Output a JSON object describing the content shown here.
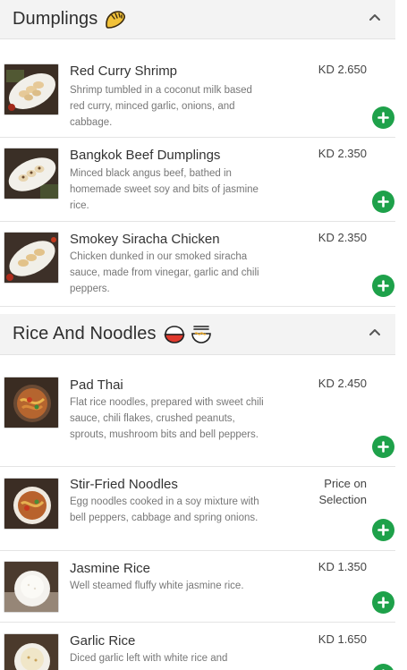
{
  "sections": [
    {
      "title": "Dumplings",
      "emoji_icons": [
        "dumpling-icon"
      ],
      "items": [
        {
          "name": "Red Curry Shrimp",
          "desc": "Shrimp tumbled in a coconut milk based red curry, minced garlic, onions, and cabbage.",
          "price": "KD 2.650",
          "image": "dumplings-photo"
        },
        {
          "name": "Bangkok Beef Dumplings",
          "desc": "Minced black angus beef, bathed in homemade sweet soy and bits of jasmine rice.",
          "price": "KD 2.350",
          "image": "dumplings-photo"
        },
        {
          "name": "Smokey Siracha Chicken",
          "desc": "Chicken dunked in our smoked siracha sauce, made from vinegar, garlic and chili peppers.",
          "price": "KD 2.350",
          "image": "dumplings-photo"
        }
      ]
    },
    {
      "title": "Rice And Noodles",
      "emoji_icons": [
        "rice-bowl-icon",
        "noodle-bowl-icon"
      ],
      "items": [
        {
          "name": "Pad Thai",
          "desc": "Flat rice noodles, prepared with sweet chili sauce, chili flakes, crushed peanuts, sprouts, mushroom bits and bell peppers.",
          "price": "KD 2.450",
          "image": "noodles-photo"
        },
        {
          "name": "Stir-Fried Noodles",
          "desc": "Egg noodles cooked in a soy mixture with bell peppers, cabbage and spring onions.",
          "price_line1": "Price on",
          "price_line2": "Selection",
          "image": "noodles-photo"
        },
        {
          "name": "Jasmine Rice",
          "desc": "Well steamed fluffy white jasmine rice.",
          "price": "KD 1.350",
          "image": "rice-photo"
        },
        {
          "name": "Garlic Rice",
          "desc": "Diced garlic left with white rice and",
          "price": "KD 1.650",
          "image": "rice-photo"
        }
      ]
    }
  ],
  "colors": {
    "add_button": "#1ea14a",
    "header_bg": "#f3f3f3",
    "description_text": "#777777"
  }
}
